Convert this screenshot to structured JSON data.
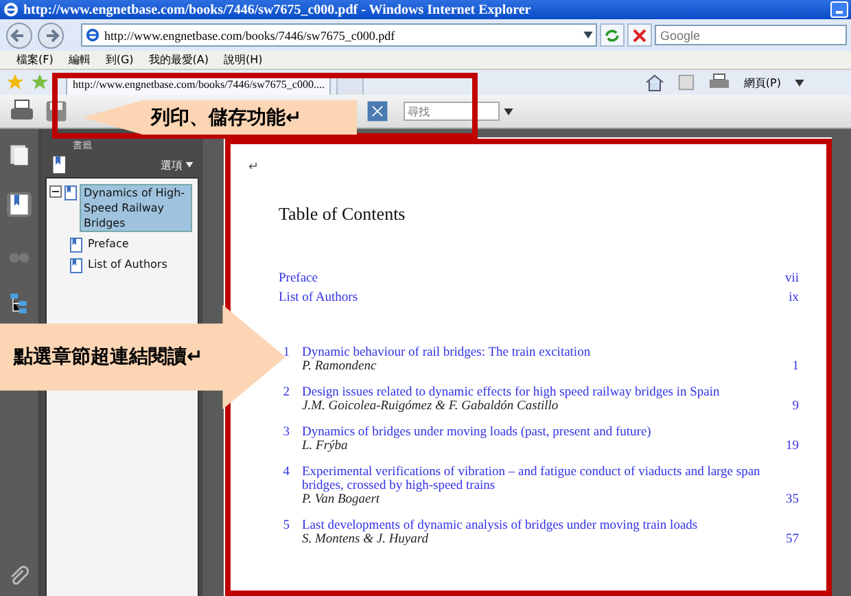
{
  "window": {
    "title": "http://www.engnetbase.com/books/7446/sw7675_c000.pdf - Windows Internet Explorer"
  },
  "address_bar": {
    "url": "http://www.engnetbase.com/books/7446/sw7675_c000.pdf",
    "search_placeholder": "Google"
  },
  "menu": [
    "檔案(F)",
    "編輯",
    "到(G)",
    "我的最愛(A)",
    "說明(H)"
  ],
  "tabs": [
    {
      "label": "http://www.engnetbase.com/books/7446/sw7675_c000....",
      "selected": true
    }
  ],
  "command_bar": {
    "page_menu": "網頁(P)"
  },
  "pdf_toolbar": {
    "find_placeholder": "尋找"
  },
  "sidebar": {
    "title": "書籤",
    "options": "選項",
    "tree": [
      {
        "label": "Dynamics of High-Speed Railway Bridges",
        "selected": true,
        "expanded": true,
        "children": [
          {
            "label": "Preface",
            "selected": false
          },
          {
            "label": "List of Authors",
            "selected": false
          }
        ]
      }
    ]
  },
  "document": {
    "mark": "↵",
    "title": "Table of Contents",
    "front": [
      {
        "title": "Preface",
        "page": "vii"
      },
      {
        "title": "List of Authors",
        "page": "ix"
      }
    ],
    "chapters": [
      {
        "number": "1",
        "title": "Dynamic behaviour of rail bridges: The train excitation",
        "authors": "P. Ramondenc",
        "page": "1"
      },
      {
        "number": "2",
        "title": "Design issues related to dynamic effects for high speed railway bridges in Spain",
        "authors": "J.M. Goicolea-Ruigómez & F. Gabaldón Castillo",
        "page": "9"
      },
      {
        "number": "3",
        "title": "Dynamics of bridges under moving loads (past, present and future)",
        "authors": "L. Frýba",
        "page": "19"
      },
      {
        "number": "4",
        "title": "Experimental verifications of vibration – and fatigue conduct of viaducts and large span bridges, crossed by high-speed trains",
        "authors": "P. Van Bogaert",
        "page": "35"
      },
      {
        "number": "5",
        "title": "Last developments of dynamic analysis of bridges under moving train loads",
        "authors": "S. Montens & J. Huyard",
        "page": "57"
      }
    ]
  },
  "callouts": [
    {
      "text": "列印、儲存功能↵",
      "kind": "left"
    },
    {
      "text": "點選章節超連結閱讀↵",
      "kind": "right"
    }
  ]
}
